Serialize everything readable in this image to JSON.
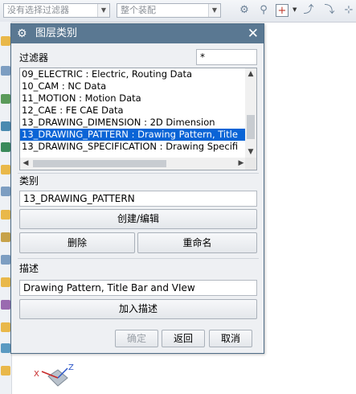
{
  "toolbar": {
    "filter_combo": "没有选择过滤器",
    "assembly_combo": "整个装配"
  },
  "dialog": {
    "title": "图层类别",
    "filter_label": "过滤器",
    "filter_value": "*",
    "list_items": [
      "09_ELECTRIC : Electric, Routing Data",
      "10_CAM : NC Data",
      "11_MOTION : Motion Data",
      "12_CAE : FE CAE Data",
      "13_DRAWING_DIMENSION : 2D Dimension",
      "13_DRAWING_PATTERN : Drawing Pattern, Title",
      "13_DRAWING_SPECIFICATION : Drawing Specifi"
    ],
    "category_label": "类别",
    "category_value": "13_DRAWING_PATTERN",
    "create_edit": "创建/编辑",
    "delete": "删除",
    "rename": "重命名",
    "description_label": "描述",
    "description_value": "Drawing Pattern, Title Bar and VIew",
    "add_description": "加入描述",
    "ok": "确定",
    "back": "返回",
    "cancel": "取消"
  },
  "colors": {
    "titlebar": "#5a7892",
    "selection": "#0a64d6"
  }
}
